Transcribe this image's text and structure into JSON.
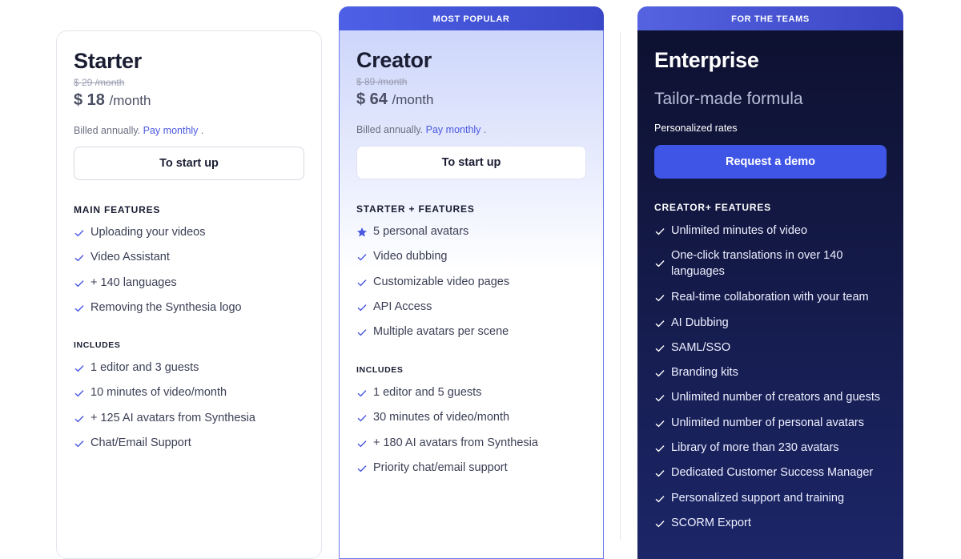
{
  "starter": {
    "name": "Starter",
    "old_price": "$ 29 /month",
    "price": "$ 18",
    "per": "/month",
    "billed_prefix": "Billed annually.",
    "billed_link": "Pay monthly",
    "billed_suffix": ".",
    "cta": "To start up",
    "features_heading": "MAIN FEATURES",
    "features": [
      "Uploading your videos",
      "Video Assistant",
      "+ 140 languages",
      "Removing the Synthesia logo"
    ],
    "includes_heading": "INCLUDES",
    "includes": [
      "1 editor and 3 guests",
      "10 minutes of video/month",
      "+ 125 AI avatars from Synthesia",
      "Chat/Email Support"
    ]
  },
  "creator": {
    "banner": "MOST POPULAR",
    "name": "Creator",
    "old_price": "$ 89 /month",
    "price": "$ 64",
    "per": "/month",
    "billed_prefix": "Billed annually.",
    "billed_link": "Pay monthly",
    "billed_suffix": ".",
    "cta": "To start up",
    "features_heading": "STARTER + FEATURES",
    "features": [
      "5 personal avatars",
      "Video dubbing",
      "Customizable video pages",
      "API Access",
      "Multiple avatars per scene"
    ],
    "includes_heading": "INCLUDES",
    "includes": [
      "1 editor and 5 guests",
      "30 minutes of video/month",
      "+ 180 AI avatars from Synthesia",
      "Priority chat/email support"
    ]
  },
  "enterprise": {
    "banner": "FOR THE TEAMS",
    "name": "Enterprise",
    "tagline": "Tailor-made formula",
    "rates": "Personalized rates",
    "cta": "Request a demo",
    "features_heading": "CREATOR+ FEATURES",
    "features": [
      "Unlimited minutes of video",
      "One-click translations in over 140 languages",
      "Real-time collaboration with your team",
      "AI Dubbing",
      "SAML/SSO",
      "Branding kits",
      "Unlimited number of creators and guests",
      "Unlimited number of personal avatars",
      "Library of more than 230 avatars",
      "Dedicated Customer Success Manager",
      "Personalized support and training",
      "SCORM Export"
    ]
  },
  "icons": {
    "check": "check-icon",
    "star": "star-icon"
  },
  "colors": {
    "accent": "#4a58e0",
    "enterprise_bg": "#141a48",
    "demo_button": "#3f55e6"
  }
}
